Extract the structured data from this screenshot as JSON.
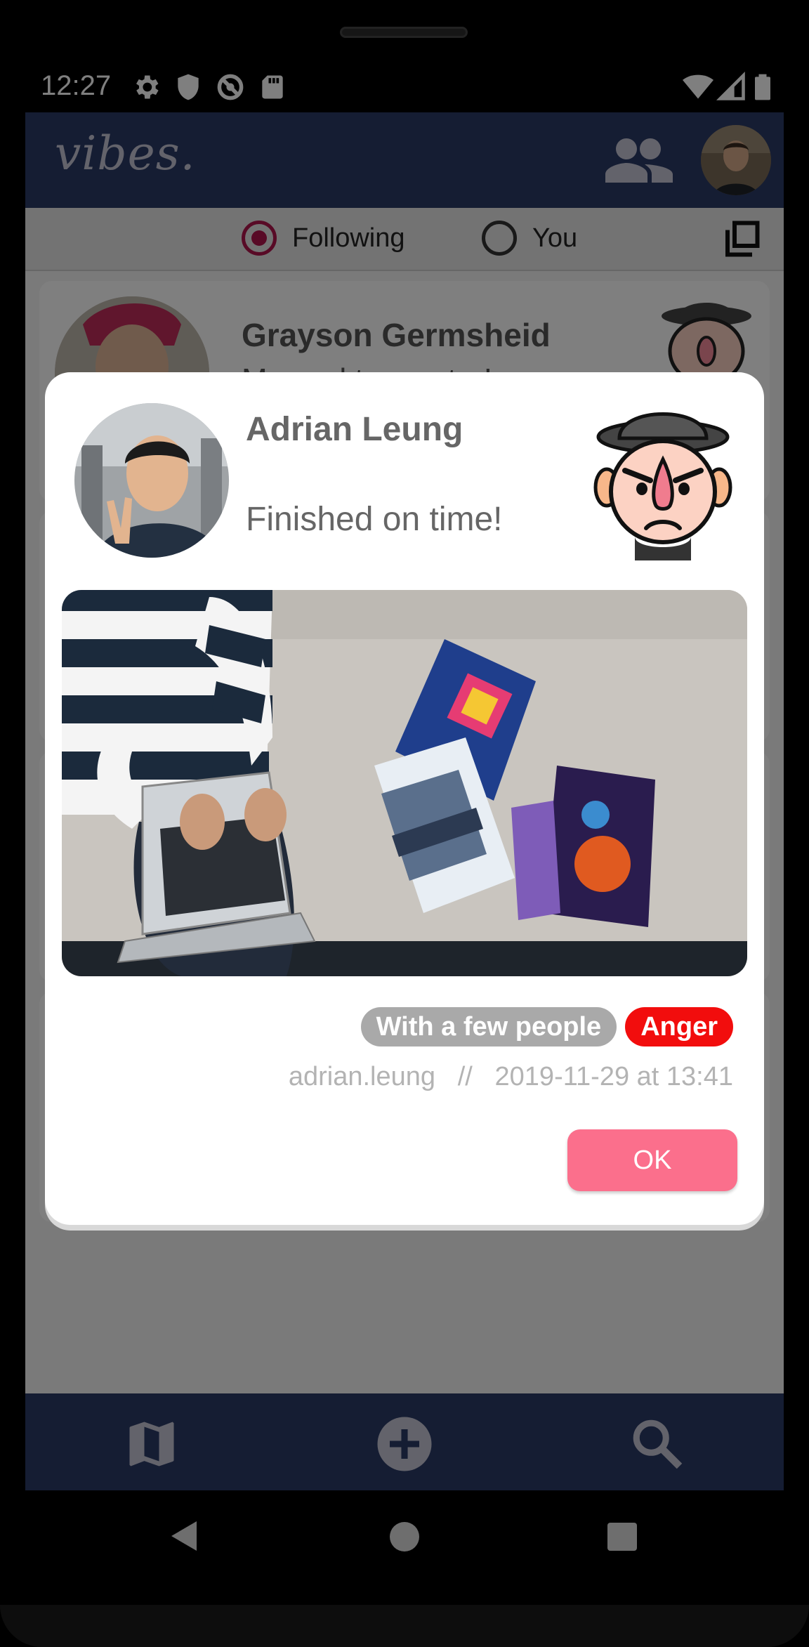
{
  "status_bar": {
    "time": "12:27",
    "icons": [
      "gear-icon",
      "shield-icon",
      "sync-disabled-icon",
      "sd-card-icon",
      "wifi-icon",
      "signal-icon",
      "battery-icon"
    ]
  },
  "app_bar": {
    "logo": "vibes.",
    "icons": [
      "people-icon",
      "profile-avatar"
    ]
  },
  "filter": {
    "options": [
      {
        "label": "Following",
        "selected": true
      },
      {
        "label": "You",
        "selected": false
      }
    ]
  },
  "feed": {
    "items": [
      {
        "name": "Grayson Germsheid",
        "message": "Merged to master!"
      }
    ]
  },
  "dialog": {
    "name": "Adrian Leung",
    "message": "Finished on time!",
    "tags": [
      {
        "label": "With a few people",
        "color": "#a9a9a9"
      },
      {
        "label": "Anger",
        "color": "#f20d0d"
      }
    ],
    "username": "adrian.leung",
    "separator": "//",
    "timestamp": "2019-11-29 at 13:41",
    "ok_label": "OK"
  },
  "bottom_nav": {
    "items": [
      "map-icon",
      "add-circle-icon",
      "search-icon"
    ]
  },
  "colors": {
    "primary": "#2b3a67",
    "accent": "#b0154c",
    "ok_button": "#fb6f8c",
    "anger": "#f20d0d"
  }
}
